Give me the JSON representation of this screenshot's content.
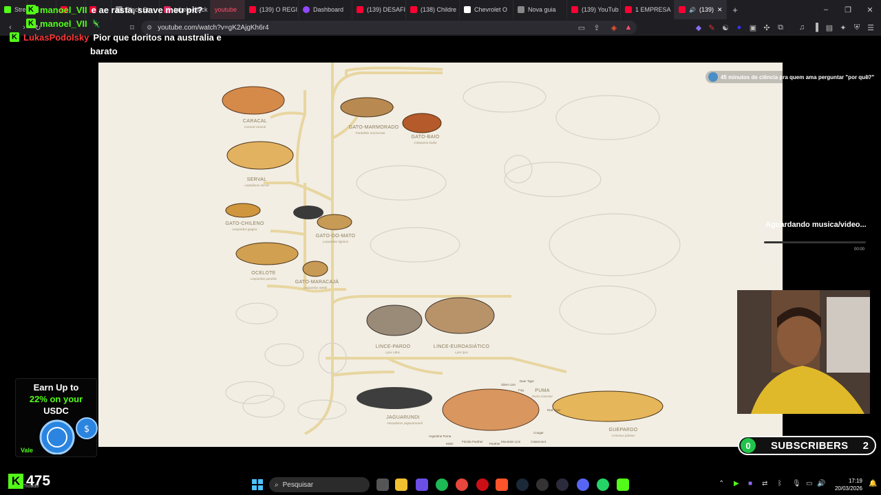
{
  "browser": {
    "tabs": [
      {
        "label": "Stre",
        "color": "#53fc18"
      },
      {
        "label": "",
        "color": "#53fc18"
      },
      {
        "label": "",
        "color": "#ff0033"
      },
      {
        "label": "",
        "color": "#ff0033"
      },
      {
        "label": "Black Str",
        "color": "#888888"
      },
      {
        "label": "tabela-black",
        "color": "#e0245e"
      },
      {
        "label": "youtube",
        "color": ""
      },
      {
        "label": "(139) O REGI",
        "color": "#ff0033"
      },
      {
        "label": "Dashboard",
        "color": "#9147ff"
      },
      {
        "label": "(139) DESAFI",
        "color": "#ff0033"
      },
      {
        "label": "(138) Childre",
        "color": "#ff0033"
      },
      {
        "label": "Chevrolet O",
        "color": "#ffffff"
      },
      {
        "label": "Nova guia",
        "color": "#888888"
      },
      {
        "label": "(139) YouTub",
        "color": "#ff0033"
      },
      {
        "label": "1 EMPRESA",
        "color": "#ff0033"
      },
      {
        "label": "(139)",
        "color": "#ff0033"
      }
    ],
    "new_tab": "+",
    "url": "youtube.com/watch?v=gK2AjgKh6r4"
  },
  "chat": [
    {
      "user": "manoel_VII",
      "message": "e ae rasta, suave meu pit?",
      "user_color": "green"
    },
    {
      "user": "manoel_VII",
      "message": "",
      "user_color": "green"
    },
    {
      "user": "LukasPodolsky",
      "message": "Pior que doritos na australia e",
      "user_color": "red"
    },
    {
      "user": "",
      "message": "barato",
      "user_color": ""
    }
  ],
  "video": {
    "species": [
      {
        "name": "CARACAL",
        "sci": "Caracal caracal"
      },
      {
        "name": "SERVAL",
        "sci": "Leptailurus serval"
      },
      {
        "name": "GATO-MARMORADO",
        "sci": "Pardofelis marmorata"
      },
      {
        "name": "GATO-BAIO",
        "sci": "Catopuma badia"
      },
      {
        "name": "GATO-CHILENO",
        "sci": "Leopardus guigna"
      },
      {
        "name": "GATO-DO-MATO",
        "sci": "Leopardus tigrinus"
      },
      {
        "name": "OCELOTE",
        "sci": "Leopardus pardalis"
      },
      {
        "name": "GATO-MARACAJÁ",
        "sci": "Leopardus wiedii"
      },
      {
        "name": "LINCE-PARDO",
        "sci": "Lynx rufus"
      },
      {
        "name": "LINCE-EUROASIÁTICO",
        "sci": "Lynx lynx"
      },
      {
        "name": "JAGUARUNDI",
        "sci": "Herpailurus yagouaroundi"
      },
      {
        "name": "PUMA",
        "sci": "Puma concolor"
      },
      {
        "name": "GUEPARDO",
        "sci": "Acinonyx jubatus"
      }
    ],
    "puma_names": [
      "Silver Lion",
      "Deer Tiger",
      "Fog",
      "Red Tiger",
      "Cougar",
      "Catamount",
      "Mountain Lion",
      "Panther",
      "Florida Panther",
      "Mishi",
      "Argentine Puma"
    ]
  },
  "overlays": {
    "notification": "45 minutos de ciência pra quem ama perguntar \"por quê?\"",
    "music_title": "Aguardando musica/video...",
    "music_time": "00:00",
    "subs_count": "0",
    "subs_label": "SUBSCRIBERS",
    "subs_goal": "2",
    "promo": [
      "Earn Up to",
      "22% on your",
      "USDC"
    ],
    "promo_footer": "Vale",
    "kick_viewers": "475",
    "kick_sub": "Ticlado"
  },
  "taskbar": {
    "search_placeholder": "Pesquisar",
    "time": "17:19",
    "date": "20/03/2026"
  }
}
